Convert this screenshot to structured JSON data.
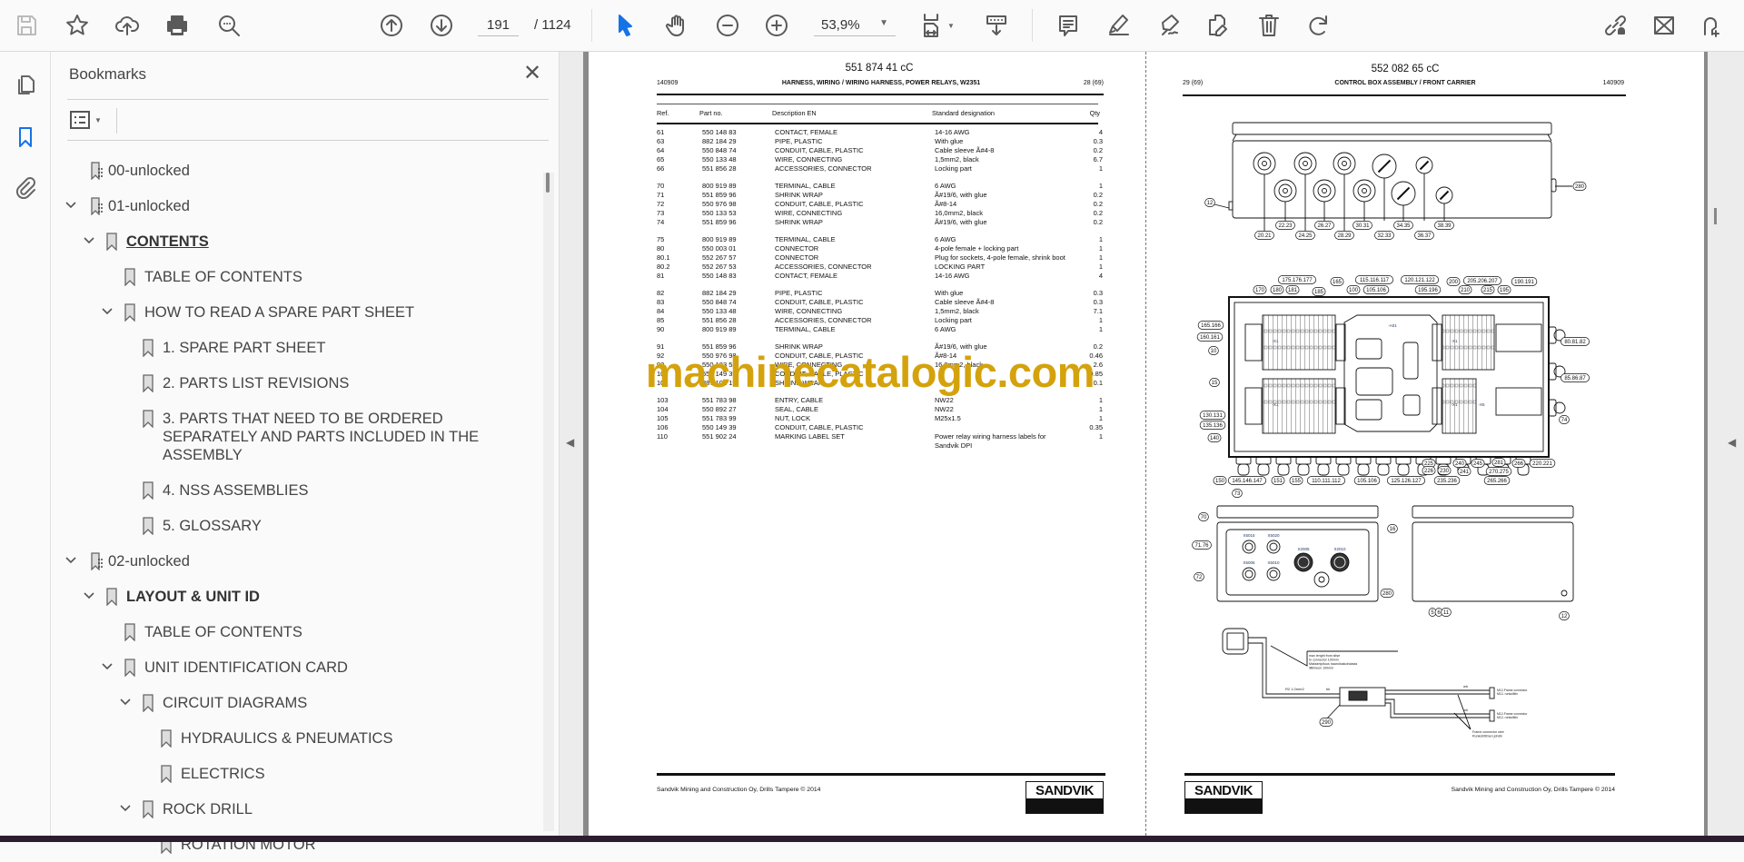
{
  "toolbar": {
    "page_current": "191",
    "page_total": "/ 1124",
    "zoom": "53,9%",
    "icons": [
      "save-icon",
      "star-icon",
      "cloud-upload-icon",
      "print-icon",
      "search-icon",
      "page-up-icon",
      "page-down-icon",
      "select-pointer-icon",
      "hand-icon",
      "zoom-out-icon",
      "zoom-in-icon",
      "page-fit-icon",
      "scroll-mode-icon",
      "comment-icon",
      "highlight-icon",
      "sign-icon",
      "fill-sign-icon",
      "delete-icon",
      "rotate-icon",
      "share-link-icon",
      "email-icon",
      "add-user-icon"
    ],
    "accent": "#1473e6"
  },
  "sidebar": {
    "title": "Bookmarks",
    "items": [
      {
        "label": "00-unlocked",
        "level": 0,
        "type": "file",
        "expanded": null
      },
      {
        "label": "01-unlocked",
        "level": 0,
        "type": "file",
        "expanded": true
      },
      {
        "label": "CONTENTS",
        "level": 1,
        "type": "bookmark",
        "expanded": true,
        "bold": true,
        "underline": true
      },
      {
        "label": "TABLE OF CONTENTS",
        "level": 2,
        "type": "bookmark",
        "expanded": null
      },
      {
        "label": "HOW TO READ A SPARE PART SHEET",
        "level": 2,
        "type": "bookmark",
        "expanded": true
      },
      {
        "label": "1. SPARE PART SHEET",
        "level": 3,
        "type": "bookmark",
        "expanded": null
      },
      {
        "label": "2. PARTS LIST REVISIONS",
        "level": 3,
        "type": "bookmark",
        "expanded": null
      },
      {
        "label": "3. PARTS THAT NEED TO BE ORDERED SEPARATELY AND PARTS INCLUDED IN THE ASSEMBLY",
        "level": 3,
        "type": "bookmark",
        "expanded": null
      },
      {
        "label": "4. NSS ASSEMBLIES",
        "level": 3,
        "type": "bookmark",
        "expanded": null
      },
      {
        "label": "5. GLOSSARY",
        "level": 3,
        "type": "bookmark",
        "expanded": null
      },
      {
        "label": "02-unlocked",
        "level": 0,
        "type": "file",
        "expanded": true
      },
      {
        "label": "LAYOUT & UNIT ID",
        "level": 1,
        "type": "bookmark",
        "expanded": true,
        "bold": true
      },
      {
        "label": "TABLE OF CONTENTS",
        "level": 2,
        "type": "bookmark",
        "expanded": null
      },
      {
        "label": "UNIT IDENTIFICATION CARD",
        "level": 2,
        "type": "bookmark",
        "expanded": true
      },
      {
        "label": "CIRCUIT DIAGRAMS",
        "level": 3,
        "type": "bookmark",
        "expanded": true
      },
      {
        "label": "HYDRAULICS & PNEUMATICS",
        "level": 4,
        "type": "bookmark",
        "expanded": null
      },
      {
        "label": "ELECTRICS",
        "level": 4,
        "type": "bookmark",
        "expanded": null
      },
      {
        "label": "ROCK DRILL",
        "level": 3,
        "type": "bookmark",
        "expanded": true
      },
      {
        "label": "ROTATION MOTOR",
        "level": 4,
        "type": "bookmark",
        "expanded": null
      }
    ]
  },
  "left_page": {
    "doc_number": "551 874 41 cC",
    "date": "140909",
    "title": "HARNESS, WIRING / WIRING HARNESS, POWER RELAYS, W2351",
    "page_ref": "28 (69)",
    "columns": [
      "Ref.",
      "Part no.",
      "Description EN",
      "Standard designation",
      "Qty"
    ],
    "groups": [
      [
        [
          "61",
          "550 148 83",
          "CONTACT, FEMALE",
          "14-16 AWG",
          "4"
        ],
        [
          "63",
          "882 184 29",
          "PIPE, PLASTIC",
          "With glue",
          "0.3"
        ],
        [
          "64",
          "550 848 74",
          "CONDUIT, CABLE, PLASTIC",
          "Cable sleeve Ã#4-8",
          "0.2"
        ],
        [
          "65",
          "550 133 48",
          "WIRE, CONNECTING",
          "1,5mm2, black",
          "6.7"
        ],
        [
          "66",
          "551 856 28",
          "ACCESSORIES, CONNECTOR",
          "Locking part",
          "1"
        ]
      ],
      [
        [
          "70",
          "800 919 89",
          "TERMINAL, CABLE",
          "6 AWG",
          "1"
        ],
        [
          "71",
          "551 859 96",
          "SHRINK WRAP",
          "Ã#19/6, with glue",
          "0.2"
        ],
        [
          "72",
          "550 976 98",
          "CONDUIT, CABLE, PLASTIC",
          "Ã#8-14",
          "0.2"
        ],
        [
          "73",
          "550 133 53",
          "WIRE, CONNECTING",
          "16,0mm2, black",
          "0.2"
        ],
        [
          "74",
          "551 859 96",
          "SHRINK WRAP",
          "Ã#19/6, with glue",
          "0.2"
        ]
      ],
      [
        [
          "75",
          "800 919 89",
          "TERMINAL, CABLE",
          "6 AWG",
          "1"
        ],
        [
          "80",
          "550 003 01",
          "CONNECTOR",
          "4-pole female + locking part",
          "1"
        ],
        [
          "80.1",
          "552 267 57",
          "CONNECTOR",
          "Plug for sockets, 4-pole female, shrink boot",
          "1"
        ],
        [
          "80.2",
          "552 267 53",
          "ACCESSORIES, CONNECTOR",
          "LOCKING PART",
          "1"
        ],
        [
          "81",
          "550 148 83",
          "CONTACT, FEMALE",
          "14-16 AWG",
          "4"
        ]
      ],
      [
        [
          "82",
          "882 184 29",
          "PIPE, PLASTIC",
          "With glue",
          "0.3"
        ],
        [
          "83",
          "550 848 74",
          "CONDUIT, CABLE, PLASTIC",
          "Cable sleeve Ã#4-8",
          "0.3"
        ],
        [
          "84",
          "550 133 48",
          "WIRE, CONNECTING",
          "1,5mm2, black",
          "7.1"
        ],
        [
          "85",
          "551 856 28",
          "ACCESSORIES, CONNECTOR",
          "Locking part",
          "1"
        ],
        [
          "90",
          "800 919 89",
          "TERMINAL, CABLE",
          "6 AWG",
          "1"
        ]
      ],
      [
        [
          "91",
          "551 859 96",
          "SHRINK WRAP",
          "Ã#19/6, with glue",
          "0.2"
        ],
        [
          "92",
          "550 976 98",
          "CONDUIT, CABLE, PLASTIC",
          "Ã#8-14",
          "0.46"
        ],
        [
          "93",
          "550 133 53",
          "WIRE, CONNECTING",
          "16,0mm2, black",
          "2.6"
        ],
        [
          "101",
          "550 149 39",
          "CONDUIT, CABLE, PLASTIC",
          "",
          "0.85"
        ],
        [
          "102",
          "887 101 19",
          "SHRINK WRAP",
          "",
          "0.1"
        ]
      ],
      [
        [
          "103",
          "551 783 98",
          "ENTRY, CABLE",
          "NW22",
          "1"
        ],
        [
          "104",
          "550 892 27",
          "SEAL, CABLE",
          "NW22",
          "1"
        ],
        [
          "105",
          "551 783 99",
          "NUT, LOCK",
          "M25x1.5",
          "1"
        ],
        [
          "106",
          "550 149 39",
          "CONDUIT, CABLE, PLASTIC",
          "",
          "0.35"
        ],
        [
          "110",
          "551 902 24",
          "MARKING LABEL SET",
          "Power relay wiring harness labels for",
          "1"
        ],
        [
          "",
          "",
          "",
          "Sandvik DPI",
          ""
        ]
      ]
    ],
    "footer": "Sandvik Mining and Construction Oy, Drills Tampere © 2014",
    "logo": "SANDVIK"
  },
  "watermark": "machinecatalogic.com",
  "right_page": {
    "doc_number": "552 082 65 cC",
    "page_ref": "29 (69)",
    "title": "CONTROL BOX ASSEMBLY / FRONT CARRIER",
    "date": "140909",
    "footer": "Sandvik Mining and Construction Oy, Drills Tampere © 2014",
    "logo": "SANDVIK",
    "callouts": [
      "12",
      "280",
      "20.21",
      "22.23",
      "24.25",
      "26.27",
      "28.29",
      "30.31",
      "32.33",
      "34.35",
      "36.37",
      "38.39",
      "175.176.177",
      "165",
      "115.116.117",
      "120.121.122",
      "200",
      "205.206.207",
      "190.191",
      "170",
      "180",
      "181",
      "185",
      "100",
      "105.106",
      "195.196",
      "210",
      "215",
      "195",
      "165.166",
      "160.161",
      "10",
      "15",
      "130.131",
      "135.136",
      "140",
      "225",
      "226",
      "230",
      "240",
      "241",
      "245",
      "281",
      "266",
      "220.221",
      "270.275",
      "265.266",
      "235.236",
      "125.126.127",
      "105.106",
      "110.111.112",
      "155",
      "151",
      "145.146.147",
      "150",
      "80.81.82",
      "85.86.87",
      "74",
      "73",
      "70",
      "71.76",
      "72",
      "16",
      "280",
      "5",
      "6",
      "11",
      "12",
      "290"
    ],
    "connector_labels": [
      "X5015",
      "X5020",
      "X5005",
      "X5010",
      "X2005",
      "X2010",
      "-A01",
      "-X1",
      "-X1",
      "-X1",
      "-X1",
      "-X5"
    ],
    "wiring_notes": {
      "note": [
        "max lenght from sitse",
        "to connector 100mm",
        "Maksimipituus haaroituskohdasta",
        "liittimeen 100mm"
      ],
      "wire_spec": "R2 1.0mm2",
      "color_bk": "bk",
      "color_wh_1": "wh",
      "color_wh_2": "wh",
      "end_1": [
        "M12-Frame connector",
        "M12- runkoliitin"
      ],
      "end_2": [
        "M12-Frame connector",
        "M12- runkoliitin"
      ],
      "frame_wire": [
        "Frame connector wire",
        "Runkoliittimen johdin"
      ]
    }
  }
}
